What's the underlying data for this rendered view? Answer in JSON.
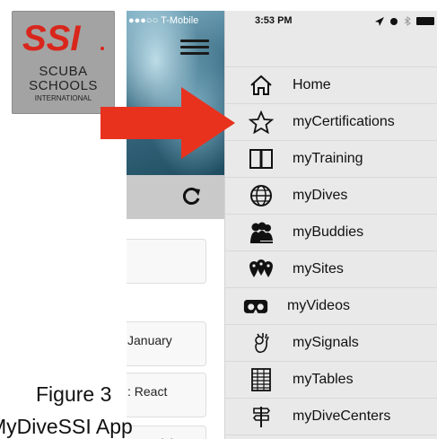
{
  "logo": {
    "line1": "SCUBA",
    "line2": "SCHOOLS",
    "line3": "INTERNATIONAL",
    "mark": "SSI"
  },
  "background_app": {
    "status_left": "●●●○○ T-Mobile",
    "cards": [
      "",
      "January",
      ": React",
      "r Special"
    ]
  },
  "menu": {
    "status_time": "3:53 PM",
    "items": [
      {
        "label": "Home",
        "icon": "home-icon"
      },
      {
        "label": "myCertifications",
        "icon": "star-icon"
      },
      {
        "label": "myTraining",
        "icon": "book-icon"
      },
      {
        "label": "myDives",
        "icon": "globe-icon"
      },
      {
        "label": "myBuddies",
        "icon": "buddies-icon"
      },
      {
        "label": "mySites",
        "icon": "sites-icon"
      },
      {
        "label": "myVideos",
        "icon": "vr-goggles-icon"
      },
      {
        "label": "mySignals",
        "icon": "ok-hand-icon"
      },
      {
        "label": "myTables",
        "icon": "table-icon"
      },
      {
        "label": "myDiveCenters",
        "icon": "signpost-icon"
      }
    ]
  },
  "caption": {
    "line1": "Figure 3",
    "line2": "MyDiveSSI App"
  },
  "colors": {
    "logo_red": "#d9261c",
    "arrow_red": "#e8321e",
    "menu_bg": "#e9e9e9"
  }
}
